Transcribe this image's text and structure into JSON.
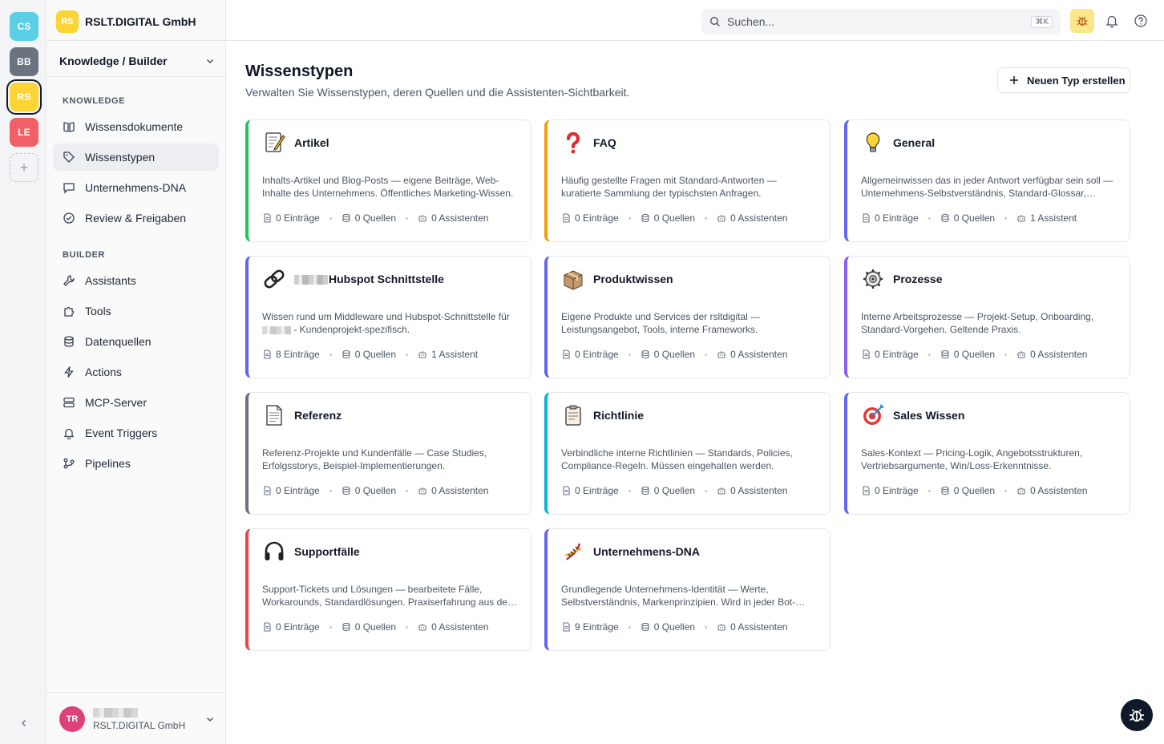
{
  "workspaces": [
    {
      "label": "CS",
      "color": "#5ccfe6"
    },
    {
      "label": "BB",
      "color": "#6b7280"
    },
    {
      "label": "RS",
      "color": "#fcd535",
      "active": true
    },
    {
      "label": "LE",
      "color": "#f06066"
    }
  ],
  "org": {
    "badge": "RS",
    "name": "RSLT.DIGITAL GmbH"
  },
  "context": {
    "label": "Knowledge / Builder"
  },
  "sidebar": {
    "knowledge_label": "KNOWLEDGE",
    "knowledge_items": [
      {
        "label": "Wissensdokumente",
        "icon": "book-icon"
      },
      {
        "label": "Wissenstypen",
        "icon": "tag-icon",
        "active": true
      },
      {
        "label": "Unternehmens-DNA",
        "icon": "chat-icon"
      },
      {
        "label": "Review & Freigaben",
        "icon": "check-circle-icon"
      }
    ],
    "builder_label": "BUILDER",
    "builder_items": [
      {
        "label": "Assistants",
        "icon": "wrench-icon"
      },
      {
        "label": "Tools",
        "icon": "puzzle-icon"
      },
      {
        "label": "Datenquellen",
        "icon": "database-icon"
      },
      {
        "label": "Actions",
        "icon": "lightning-icon"
      },
      {
        "label": "MCP-Server",
        "icon": "server-icon"
      },
      {
        "label": "Event Triggers",
        "icon": "bell-icon"
      },
      {
        "label": "Pipelines",
        "icon": "pipeline-icon"
      }
    ]
  },
  "user": {
    "initials": "TR",
    "name": "",
    "org": "RSLT.DIGITAL GmbH"
  },
  "topbar": {
    "search_placeholder": "Suchen...",
    "shortcut": "⌘K"
  },
  "page": {
    "title": "Wissenstypen",
    "subtitle": "Verwalten Sie Wissenstypen, deren Quellen und die Assistenten-Sichtbarkeit.",
    "new_button": "Neuen Typ erstellen"
  },
  "cards": [
    {
      "title": "Artikel",
      "icon": "memo-icon",
      "accent": "#22c55e",
      "desc": "Inhalts-Artikel und Blog-Posts — eigene Beiträge, Web-Inhalte des Unternehmens. Öffentliches Marketing-Wissen.",
      "entries": "0 Einträge",
      "sources": "0 Quellen",
      "assistants": "0 Assistenten"
    },
    {
      "title": "FAQ",
      "icon": "question-icon",
      "accent": "#f59e0b",
      "desc": "Häufig gestellte Fragen mit Standard-Antworten — kuratierte Sammlung der typischsten Anfragen.",
      "entries": "0 Einträge",
      "sources": "0 Quellen",
      "assistants": "0 Assistenten"
    },
    {
      "title": "General",
      "icon": "lightbulb-icon",
      "accent": "#6366f1",
      "desc": "Allgemeinwissen das in jeder Antwort verfügbar sein soll — Unternehmens-Selbstverständnis, Standard-Glossar, Kernbotschaften.",
      "entries": "0 Einträge",
      "sources": "0 Quellen",
      "assistants": "1 Assistent"
    },
    {
      "title": "Hubspot Schnittstelle",
      "icon": "link-icon",
      "accent": "#6366f1",
      "redacted_prefix": true,
      "desc_before": "Wissen rund um Middleware und Hubspot-Schnittstelle für",
      "desc_after": "- Kundenprojekt-spezifisch.",
      "entries": "8 Einträge",
      "sources": "0 Quellen",
      "assistants": "1 Assistent"
    },
    {
      "title": "Produktwissen",
      "icon": "box-icon",
      "accent": "#6366f1",
      "desc": "Eigene Produkte und Services der rsltdigital — Leistungsangebot, Tools, interne Frameworks.",
      "entries": "0 Einträge",
      "sources": "0 Quellen",
      "assistants": "0 Assistenten"
    },
    {
      "title": "Prozesse",
      "icon": "gear-icon",
      "accent": "#8b5cf6",
      "desc": "Interne Arbeitsprozesse — Projekt-Setup, Onboarding, Standard-Vorgehen. Geltende Praxis.",
      "entries": "0 Einträge",
      "sources": "0 Quellen",
      "assistants": "0 Assistenten"
    },
    {
      "title": "Referenz",
      "icon": "document-icon",
      "accent": "#6b7280",
      "desc": "Referenz-Projekte und Kundenfälle — Case Studies, Erfolgsstorys, Beispiel-Implementierungen.",
      "entries": "0 Einträge",
      "sources": "0 Quellen",
      "assistants": "0 Assistenten"
    },
    {
      "title": "Richtlinie",
      "icon": "clipboard-icon",
      "accent": "#06b6d4",
      "desc": "Verbindliche interne Richtlinien — Standards, Policies, Compliance-Regeln. Müssen eingehalten werden.",
      "entries": "0 Einträge",
      "sources": "0 Quellen",
      "assistants": "0 Assistenten"
    },
    {
      "title": "Sales Wissen",
      "icon": "target-icon",
      "accent": "#6366f1",
      "desc": "Sales-Kontext — Pricing-Logik, Angebotsstrukturen, Vertriebsargumente, Win/Loss-Erkenntnisse.",
      "entries": "0 Einträge",
      "sources": "0 Quellen",
      "assistants": "0 Assistenten"
    },
    {
      "title": "Supportfälle",
      "icon": "headphones-icon",
      "accent": "#ef4444",
      "desc": "Support-Tickets und Lösungen — bearbeitete Fälle, Workarounds, Standardlösungen. Praxiserfahrung aus dem Kundensupport.",
      "entries": "0 Einträge",
      "sources": "0 Quellen",
      "assistants": "0 Assistenten"
    },
    {
      "title": "Unternehmens-DNA",
      "icon": "dna-icon",
      "accent": "#6366f1",
      "desc": "Grundlegende Unternehmens-Identität — Werte, Selbstverständnis, Markenprinzipien. Wird in jeder Bot-Antwort berücksichtigt.",
      "entries": "9 Einträge",
      "sources": "0 Quellen",
      "assistants": "0 Assistenten"
    }
  ]
}
